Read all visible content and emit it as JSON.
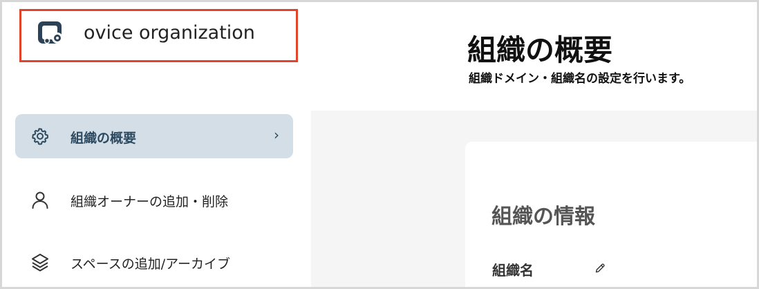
{
  "org": {
    "name": "ovice organization",
    "logo_icon": "organization-logo-icon"
  },
  "header": {
    "title": "組織の概要",
    "subtitle": "組織ドメイン・組織名の設定を行います。"
  },
  "sidebar": {
    "items": [
      {
        "label": "組織の概要",
        "icon": "gear-icon",
        "active": true,
        "chevron": "›"
      },
      {
        "label": "組織オーナーの追加・削除",
        "icon": "person-icon",
        "active": false
      },
      {
        "label": "スペースの追加/アーカイブ",
        "icon": "layers-icon",
        "active": false
      }
    ]
  },
  "card": {
    "title": "組織の情報",
    "fields": [
      {
        "label": "組織名",
        "icon": "pencil-icon"
      }
    ]
  },
  "colors": {
    "highlight_border": "#e0442a",
    "active_nav_bg": "#d3dee7",
    "active_nav_text": "#2d4a60",
    "content_bg": "#f5f5f6"
  }
}
